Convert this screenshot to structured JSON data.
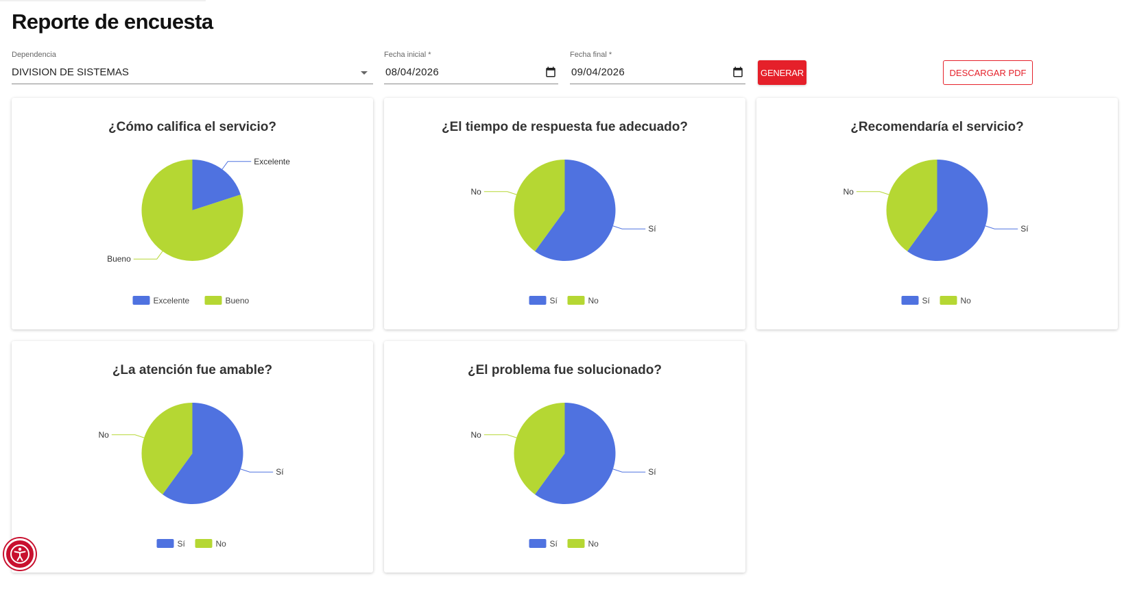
{
  "page": {
    "title": "Reporte de encuesta"
  },
  "filters": {
    "dependencia": {
      "label": "Dependencia",
      "value": "DIVISION DE SISTEMAS"
    },
    "fecha_inicial": {
      "label": "Fecha inicial *",
      "value": "08/04/2026"
    },
    "fecha_final": {
      "label": "Fecha final *",
      "value": "09/04/2026"
    },
    "generar_label": "GENERAR",
    "pdf_label": "DESCARGAR PDF"
  },
  "colors": {
    "blue": "#4f72e0",
    "green": "#b5d733",
    "accent": "#e5202a"
  },
  "icons": {
    "calendar": "calendar-icon",
    "dropdown": "chevron-down-icon",
    "accessibility": "accessibility-icon"
  },
  "chart_data": [
    {
      "type": "pie",
      "title": "¿Cómo califica el servicio?",
      "categories": [
        "Excelente",
        "Bueno"
      ],
      "values": [
        20,
        80
      ]
    },
    {
      "type": "pie",
      "title": "¿El tiempo de respuesta fue adecuado?",
      "categories": [
        "Sí",
        "No"
      ],
      "values": [
        60,
        40
      ]
    },
    {
      "type": "pie",
      "title": "¿Recomendaría el servicio?",
      "categories": [
        "Sí",
        "No"
      ],
      "values": [
        60,
        40
      ]
    },
    {
      "type": "pie",
      "title": "¿La atención fue amable?",
      "categories": [
        "Sí",
        "No"
      ],
      "values": [
        60,
        40
      ]
    },
    {
      "type": "pie",
      "title": "¿El problema fue solucionado?",
      "categories": [
        "Sí",
        "No"
      ],
      "values": [
        60,
        40
      ]
    }
  ]
}
